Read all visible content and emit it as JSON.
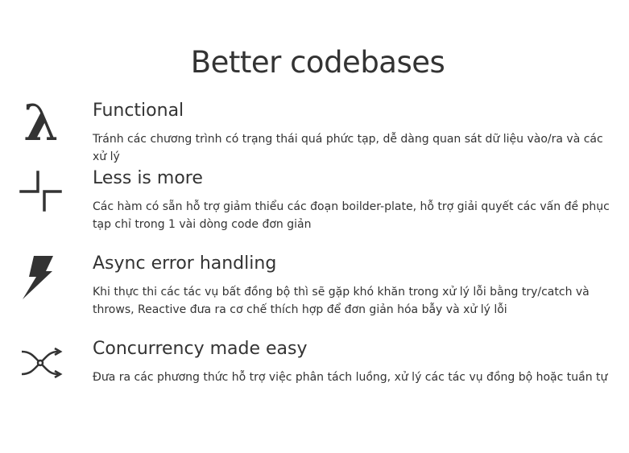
{
  "page": {
    "title": "Better codebases"
  },
  "features": [
    {
      "icon": "lambda-icon",
      "icon_glyph": "λ",
      "title": "Functional",
      "description": "Tránh các chương trình có trạng thái quá phức tạp, dễ dàng quan sát dữ liệu vào/ra và các xử lý"
    },
    {
      "icon": "crosshair-corners-icon",
      "title": "Less is more",
      "description": "Các hàm có sẵn hỗ trợ giảm thiểu các đoạn boilder-plate, hỗ trợ giải quyết các vấn đề phục tạp chỉ trong 1 vài dòng code đơn giản"
    },
    {
      "icon": "lightning-bolt-icon",
      "title": "Async error handling",
      "description": "Khi thực thi các tác vụ bất đồng bộ thì sẽ gặp khó khăn trong xử lý lỗi bằng try/catch và throws, Reactive đưa ra cơ chế thích hợp để đơn giản hóa bẫy và xử lý lỗi"
    },
    {
      "icon": "split-arrows-icon",
      "title": "Concurrency made easy",
      "description": "Đưa ra các phương thức hỗ trợ việc phân tách luồng, xử lý các tác vụ đồng bộ hoặc tuần tự"
    }
  ],
  "colors": {
    "text": "#333333",
    "background": "#ffffff"
  }
}
